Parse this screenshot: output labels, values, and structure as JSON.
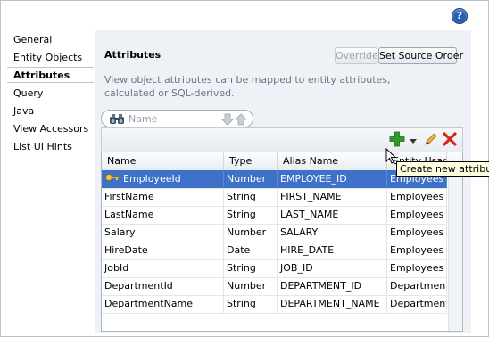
{
  "help": {
    "label": "?"
  },
  "nav": {
    "items": [
      {
        "label": "General"
      },
      {
        "label": "Entity Objects"
      },
      {
        "label": "Attributes",
        "selected": true
      },
      {
        "label": "Query"
      },
      {
        "label": "Java"
      },
      {
        "label": "View Accessors"
      },
      {
        "label": "List UI Hints"
      }
    ]
  },
  "panel": {
    "title": "Attributes",
    "override_label": "Override",
    "set_source_order_label": "Set Source Order",
    "description": "View object attributes can be mapped to entity attributes, calculated or SQL-derived."
  },
  "search": {
    "placeholder": "Name",
    "icon": "binoculars-icon"
  },
  "toolbar": {
    "add_icon": "plus-icon",
    "dropdown_icon": "chevron-down-icon",
    "edit_icon": "pencil-icon",
    "delete_icon": "delete-x-icon"
  },
  "table": {
    "columns": [
      "Name",
      "Type",
      "Alias Name",
      "Entity Usage"
    ],
    "rows": [
      {
        "name": "EmployeeId",
        "type": "Number",
        "alias": "EMPLOYEE_ID",
        "usage": "Employees",
        "key": true,
        "selected": true
      },
      {
        "name": "FirstName",
        "type": "String",
        "alias": "FIRST_NAME",
        "usage": "Employees"
      },
      {
        "name": "LastName",
        "type": "String",
        "alias": "LAST_NAME",
        "usage": "Employees"
      },
      {
        "name": "Salary",
        "type": "Number",
        "alias": "SALARY",
        "usage": "Employees"
      },
      {
        "name": "HireDate",
        "type": "Date",
        "alias": "HIRE_DATE",
        "usage": "Employees"
      },
      {
        "name": "JobId",
        "type": "String",
        "alias": "JOB_ID",
        "usage": "Employees"
      },
      {
        "name": "DepartmentId",
        "type": "Number",
        "alias": "DEPARTMENT_ID",
        "usage": "Departments"
      },
      {
        "name": "DepartmentName",
        "type": "String",
        "alias": "DEPARTMENT_NAME",
        "usage": "Departments"
      }
    ]
  },
  "tooltip": {
    "text": "Create new attribute"
  },
  "colors": {
    "selection": "#3e72c9",
    "add_green": "#2e9a2e",
    "delete_red": "#d22a1e",
    "help_blue": "#2a5eb0"
  }
}
